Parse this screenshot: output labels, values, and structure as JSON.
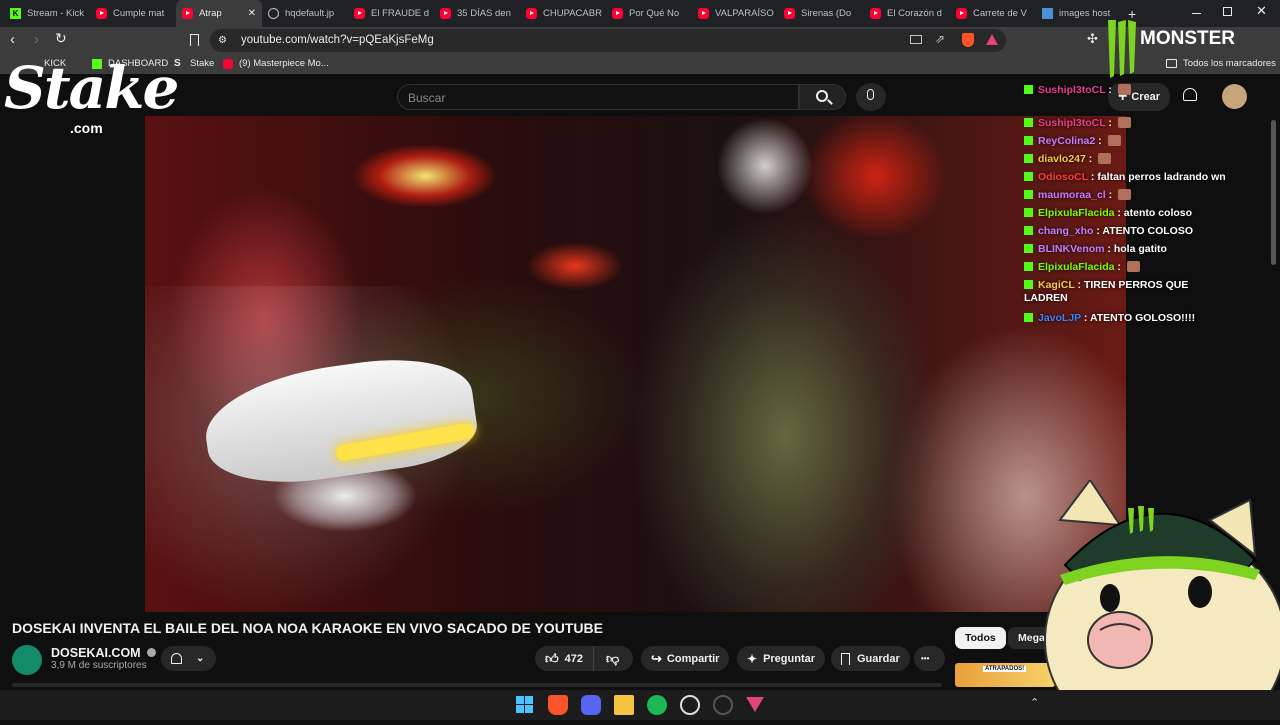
{
  "browser": {
    "tabs": [
      {
        "label": "Stream - Kick",
        "icon": "kick-favicon",
        "active": false
      },
      {
        "label": "Cumple mat",
        "icon": "youtube-favicon",
        "active": false
      },
      {
        "label": "Atrap",
        "icon": "youtube-favicon",
        "active": true
      },
      {
        "label": "hqdefault.jp",
        "icon": "globe-favicon",
        "active": false
      },
      {
        "label": "El FRAUDE d",
        "icon": "youtube-favicon",
        "active": false
      },
      {
        "label": "35 DÍAS den",
        "icon": "youtube-favicon",
        "active": false
      },
      {
        "label": "CHUPACABR",
        "icon": "youtube-favicon",
        "active": false
      },
      {
        "label": "Por Qué No",
        "icon": "youtube-favicon",
        "active": false
      },
      {
        "label": "VALPARAÍSO",
        "icon": "youtube-favicon",
        "active": false
      },
      {
        "label": "Sirenas (Do",
        "icon": "youtube-favicon",
        "active": false
      },
      {
        "label": "El Corazón d",
        "icon": "youtube-favicon",
        "active": false
      },
      {
        "label": "Carrete de V",
        "icon": "youtube-favicon",
        "active": false
      },
      {
        "label": "images host",
        "icon": "images-favicon",
        "active": false
      }
    ],
    "new_tab": "+",
    "url": "youtube.com/watch?v=pQEaKjsFeMg",
    "bookmarks": [
      {
        "label": "KICK",
        "icon": "kick-icon"
      },
      {
        "label": "DASHBOARD",
        "icon": "kick-icon"
      },
      {
        "label": "Stake",
        "icon": "stake-icon"
      },
      {
        "label": "(9) Masterpiece Mo...",
        "icon": "youtube-icon"
      }
    ],
    "all_bookmarks": "Todos los marcadores"
  },
  "youtube": {
    "search_placeholder": "Buscar",
    "create_label": "Crear",
    "video_title": "DOSEKAI INVENTA EL BAILE DEL NOA NOA KARAOKE EN VIVO SACADO DE YOUTUBE",
    "channel_name": "DOSEKAI.COM",
    "subscribers": "3,9 M de suscriptores",
    "likes": "472",
    "share_label": "Compartir",
    "ask_label": "Preguntar",
    "save_label": "Guardar",
    "more_label": "•••",
    "chips": [
      "Todos",
      "Meganot"
    ],
    "thumb_text": "ATRAPADOS!"
  },
  "overlay": {
    "stake_logo": "Stake",
    "stake_sub": ".com",
    "monster_text": "MONSTER",
    "chat": [
      {
        "user": "Sushipl3toCL",
        "color": "#e83e8c",
        "text": "",
        "emote": true
      },
      {
        "user": "Sushipl3toCL",
        "color": "#e83e8c",
        "text": "",
        "emote": true
      },
      {
        "user": "ReyColina2",
        "color": "#c77dff",
        "text": "",
        "emote": true
      },
      {
        "user": "diavlo247",
        "color": "#f7c948",
        "text": "",
        "emote": true
      },
      {
        "user": "OdiosoCL",
        "color": "#ff3b3b",
        "text": "faltan perros ladrando wn",
        "emote": false
      },
      {
        "user": "maumoraa_cl",
        "color": "#c77dff",
        "text": "",
        "emote": true
      },
      {
        "user": "ElpixulaFlacida",
        "color": "#7cfc00",
        "text": "atento coloso",
        "emote": false
      },
      {
        "user": "chang_xho",
        "color": "#c77dff",
        "text": "ATENTO COLOSO",
        "emote": false
      },
      {
        "user": "BLINKVenom",
        "color": "#c77dff",
        "text": "hola gatito",
        "emote": false
      },
      {
        "user": "ElpixulaFlacida",
        "color": "#7cfc00",
        "text": "",
        "emote": true
      },
      {
        "user": "KagiCL",
        "color": "#f7c948",
        "text": "TIREN PERROS QUE",
        "emote": false
      },
      {
        "user": "",
        "color": "#ffffff",
        "text": "LADREN",
        "emote": false
      },
      {
        "user": "JavoLJP",
        "color": "#3b82f6",
        "text": "ATENTO GOLOSO!!!!",
        "emote": false
      }
    ]
  },
  "colors": {
    "kick_green": "#53fc18",
    "youtube_red": "#ff0033",
    "background": "#0f0f0f"
  }
}
